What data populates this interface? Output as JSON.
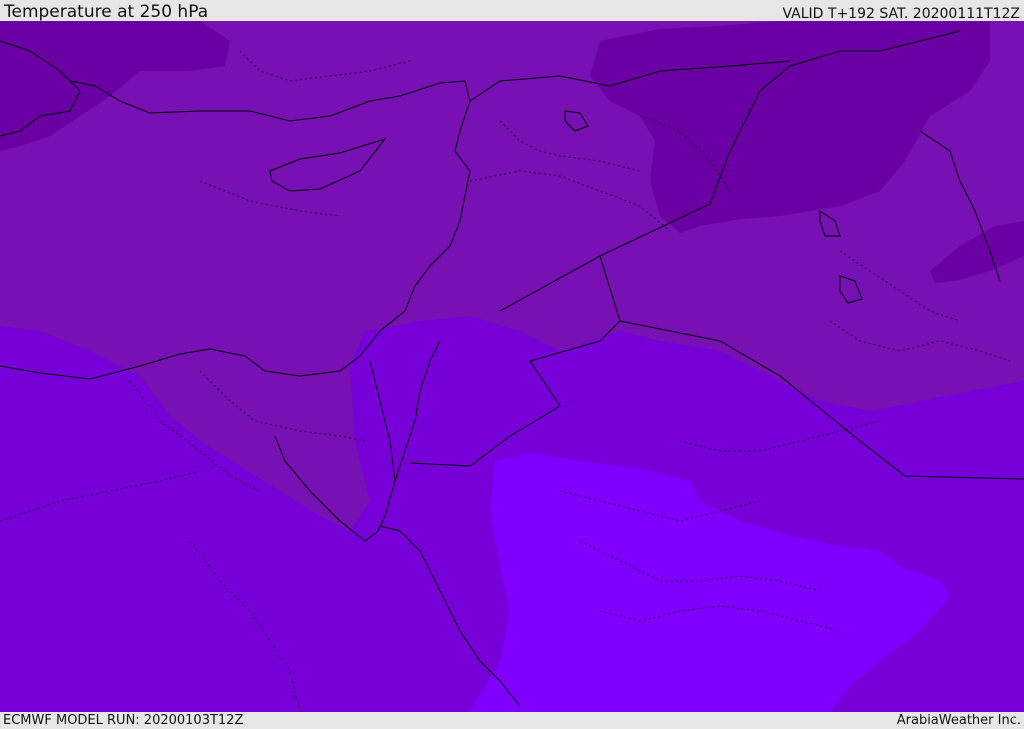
{
  "header": {
    "title": "Temperature at 250 hPa",
    "valid": "VALID T+192 SAT. 20200111T12Z"
  },
  "footer": {
    "model_run": "ECMWF MODEL RUN: 20200103T12Z",
    "credit": "ArabiaWeather Inc."
  },
  "map": {
    "region": "Middle East / Eastern Mediterranean",
    "colors": {
      "darkest": "#6a00a3",
      "dark": "#7711b4",
      "mid_dark": "#7a12bc",
      "mid": "#7700d8",
      "light": "#8000ff",
      "coast": "#000000"
    }
  }
}
